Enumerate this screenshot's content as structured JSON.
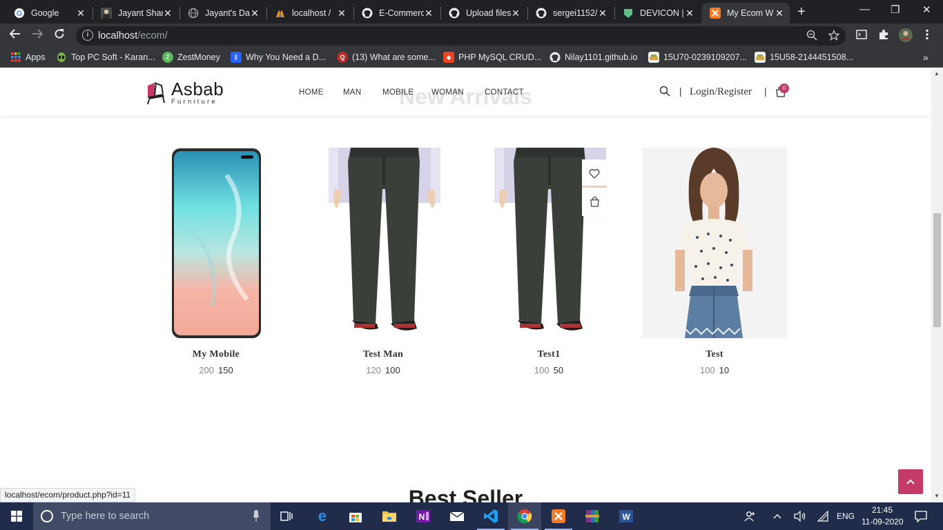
{
  "browser": {
    "tabs": [
      {
        "title": "Google",
        "icon": "google-icon",
        "color": "#4285f4"
      },
      {
        "title": "Jayant Shar",
        "icon": "profile-icon",
        "color": "#6d6d6d"
      },
      {
        "title": "Jayant's Da",
        "icon": "globe-icon",
        "color": "#5f6368"
      },
      {
        "title": "localhost /",
        "icon": "phpmyadmin-icon",
        "color": "#f29111"
      },
      {
        "title": "E-Commerc",
        "icon": "github-icon",
        "color": "#e8eaed"
      },
      {
        "title": "Upload files",
        "icon": "github-icon",
        "color": "#e8eaed"
      },
      {
        "title": "sergei1152/",
        "icon": "github-icon",
        "color": "#e8eaed"
      },
      {
        "title": "DEVICON |",
        "icon": "devicon-icon",
        "color": "#60be86"
      },
      {
        "title": "My Ecom W",
        "icon": "xampp-icon",
        "color": "#fb7a24"
      }
    ],
    "url_host": "localhost",
    "url_path": "/ecom/",
    "bookmarks": [
      {
        "label": "Apps",
        "icon": "apps-grid-icon",
        "color": "#e8eaed"
      },
      {
        "label": "Top PC Soft - Karan...",
        "icon": "alien-icon",
        "color": "#7cb342"
      },
      {
        "label": "ZestMoney",
        "icon": "zestmoney-icon",
        "color": "#5cb85c"
      },
      {
        "label": "Why You Need a D...",
        "icon": "bluetooth-icon",
        "color": "#2962ff"
      },
      {
        "label": "(13) What are some...",
        "icon": "quora-icon",
        "color": "#b92b27"
      },
      {
        "label": "PHP MySQL CRUD...",
        "icon": "codeigniter-icon",
        "color": "#ee4323"
      },
      {
        "label": "Nilay1101.github.io",
        "icon": "github-icon",
        "color": "#e8eaed"
      },
      {
        "label": "15U70-0239109207...",
        "icon": "image-icon",
        "color": "#d4a64a"
      },
      {
        "label": "15U58-2144451508...",
        "icon": "image-icon",
        "color": "#d4a64a"
      }
    ]
  },
  "site": {
    "brand": "Asbab",
    "brand_sub": "Furniture",
    "nav": [
      "HOME",
      "MAN",
      "MOBILE",
      "WOMAN",
      "CONTACT"
    ],
    "login": "Login/Register",
    "cart_count": "0",
    "section_title": "New Arrivals",
    "next_section_title": "Best Seller",
    "accent_color": "#c43b68",
    "products": [
      {
        "name": "My Mobile",
        "old_price": "200",
        "price": "150"
      },
      {
        "name": "Test Man",
        "old_price": "120",
        "price": "100"
      },
      {
        "name": "Test1",
        "old_price": "100",
        "price": "50"
      },
      {
        "name": "Test",
        "old_price": "100",
        "price": "10"
      }
    ],
    "status_url": "localhost/ecom/product.php?id=11"
  },
  "taskbar": {
    "search_placeholder": "Type here to search",
    "language": "ENG",
    "time": "21:45",
    "date": "11-09-2020"
  }
}
